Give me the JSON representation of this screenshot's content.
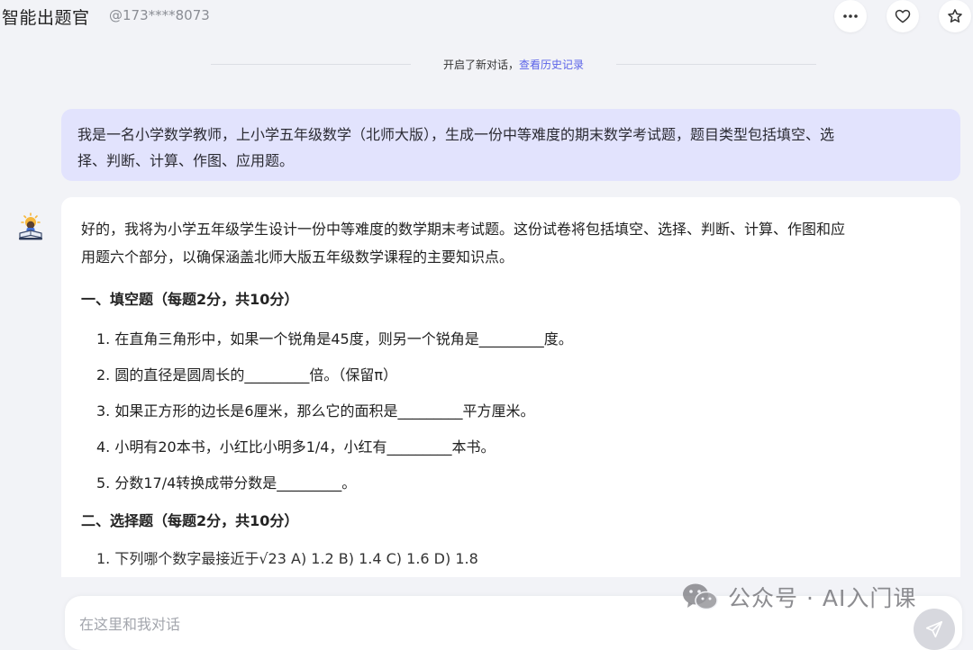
{
  "header": {
    "app_title": "智能出题官",
    "user_id": "@173****8073",
    "icons": [
      "more-icon",
      "heart-icon",
      "star-icon"
    ]
  },
  "divider": {
    "text": "开启了新对话，",
    "link": "查看历史记录"
  },
  "user_message": {
    "line1": "我是一名小学数学教师，上小学五年级数学（北师大版），生成一份中等难度的期末数学考试题，题目类型包括填空、选",
    "line2": "择、判断、计算、作图、应用题。"
  },
  "assistant": {
    "avatar_icon": "teacher-avatar-icon",
    "intro_line1": "好的，我将为小学五年级学生设计一份中等难度的数学期末考试题。这份试卷将包括填空、选择、判断、计算、作图和应",
    "intro_line2": "用题六个部分，以确保涵盖北师大版五年级数学课程的主要知识点。",
    "section1": {
      "heading": "一、填空题（每题2分，共10分）",
      "questions": [
        "1. 在直角三角形中，如果一个锐角是45度，则另一个锐角是_________度。",
        "2. 圆的直径是圆周长的_________倍。（保留π）",
        "3. 如果正方形的边长是6厘米，那么它的面积是_________平方厘米。",
        "4. 小明有20本书，小红比小明多1/4，小红有_________本书。",
        "5. 分数17/4转换成带分数是_________。"
      ]
    },
    "section2": {
      "heading": "二、选择题（每题2分，共10分）",
      "partial_question": "1. 下列哪个数字最接近于√23 A) 1.2 B) 1.4 C) 1.6 D) 1.8"
    }
  },
  "input": {
    "placeholder": "在这里和我对话",
    "value": ""
  },
  "watermark": {
    "text": "公众号 · AI入门课"
  },
  "colors": {
    "accent": "#5b63e8",
    "user_bubble": "#e2e3fd",
    "page_bg": "#f2f3f7"
  }
}
